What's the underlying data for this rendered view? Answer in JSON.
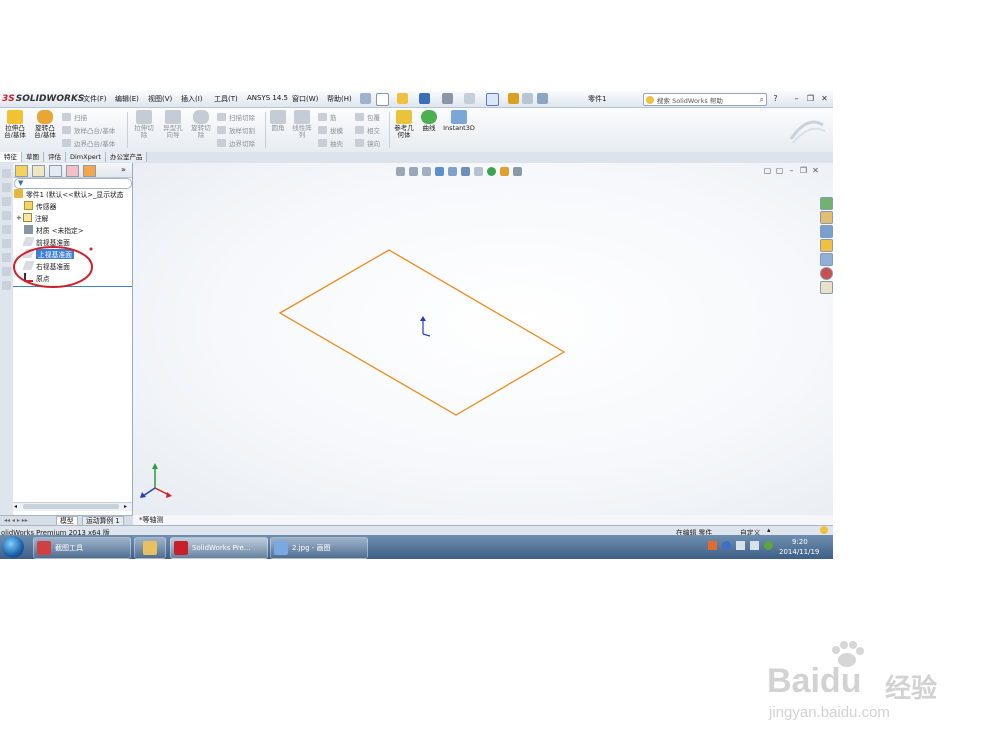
{
  "app": {
    "logo_ds": "3S",
    "logo_text": "SOLIDWORKS",
    "document_title": "零件1",
    "help_search_placeholder": "搜索 SolidWorks 帮助"
  },
  "menu": [
    "文件(F)",
    "编辑(E)",
    "视图(V)",
    "插入(I)",
    "工具(T)",
    "ANSYS 14.5",
    "窗口(W)",
    "帮助(H)"
  ],
  "ribbon": {
    "extrude_boss": "拉伸凸\n台/基体",
    "revolve_boss": "旋转凸\n台/基体",
    "sweep": "扫描",
    "loft_boss": "放样凸台/基体",
    "boundary_boss": "边界凸台/基体",
    "extrude_cut": "拉伸切\n除",
    "hole_wizard": "异型孔\n向导",
    "revolve_cut": "旋转切\n除",
    "sweep_cut": "扫描切除",
    "loft_cut": "放样切割",
    "boundary_cut": "边界切除",
    "fillet": "圆角",
    "linear_pattern": "线性阵\n列",
    "rib": "筋",
    "draft": "拔模",
    "shell": "抽壳",
    "wrap": "包覆",
    "intersect": "相交",
    "mirror": "镜向",
    "ref_geometry": "参考几\n何体",
    "curves": "曲线",
    "instant3d": "Instant3D"
  },
  "tabs": [
    "特征",
    "草图",
    "评估",
    "DimXpert",
    "办公室产品"
  ],
  "tree": {
    "root": "零件1 (默认<<默认>_显示状态",
    "items": [
      "传感器",
      "注解",
      "材质 <未指定>",
      "前视基准面",
      "上视基准面",
      "右视基准面",
      "原点"
    ],
    "selected_index": 4
  },
  "graphics": {
    "view_label": "*等轴测",
    "plane_color": "#f08a1c"
  },
  "bottom_tabs": [
    "模型",
    "运动算例 1"
  ],
  "status": {
    "left": "olidWorks Premium 2013 x64 版",
    "editing": "在编辑 零件",
    "custom": "自定义"
  },
  "taskbar": {
    "items": [
      "截图工具",
      "SolidWorks Pre...",
      "2.jpg - 画图"
    ],
    "time": "9:20",
    "date": "2014/11/19"
  },
  "annotation_color": "#d0202a",
  "watermark": {
    "brand_left": "Bai",
    "brand_right": "du",
    "brand_cn": "经验",
    "url": "jingyan.baidu.com"
  }
}
